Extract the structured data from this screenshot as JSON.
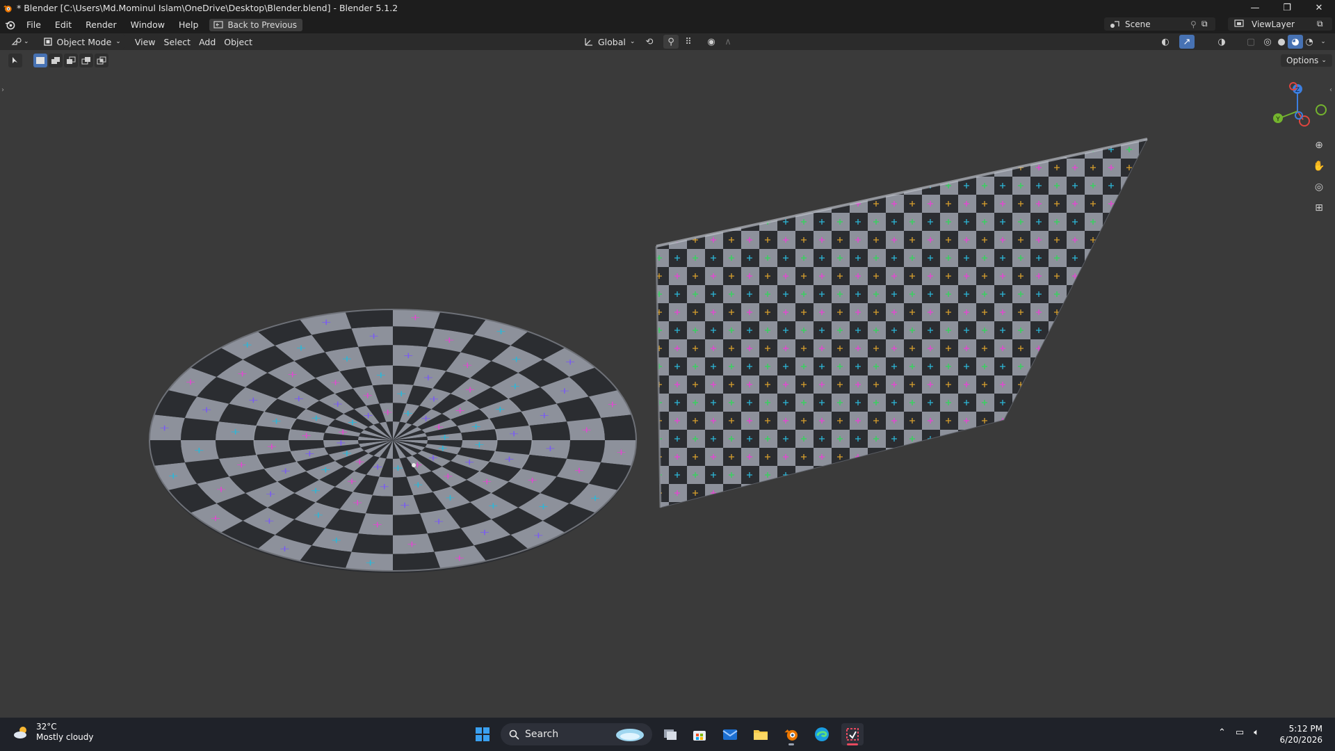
{
  "titlebar": {
    "title": "* Blender [C:\\Users\\Md.Mominul Islam\\OneDrive\\Desktop\\Blender.blend] - Blender 5.1.2",
    "minimize": "—",
    "restore": "❐",
    "close": "✕"
  },
  "menubar": {
    "items": [
      "File",
      "Edit",
      "Render",
      "Window",
      "Help"
    ],
    "back_label": "Back to Previous",
    "scene_label": "Scene",
    "viewlayer_label": "ViewLayer"
  },
  "viewport_header": {
    "mode_label": "Object Mode",
    "menus": [
      "View",
      "Select",
      "Add",
      "Object"
    ],
    "transform_orientation": "Global",
    "options_label": "Options"
  },
  "gizmo": {
    "z_label": "Z",
    "y_label": "Y",
    "x_color": "#e0453f",
    "y_color": "#74b42e",
    "z_color": "#3c7fe0"
  },
  "taskbar": {
    "temperature": "32°C",
    "weather": "Mostly cloudy",
    "search_placeholder": "Search",
    "time": "5:12 PM",
    "date": "6/20/2026"
  },
  "colors": {
    "accent": "#4772b3",
    "checker_light": "#8d919b",
    "checker_dark": "#2b2d31"
  }
}
